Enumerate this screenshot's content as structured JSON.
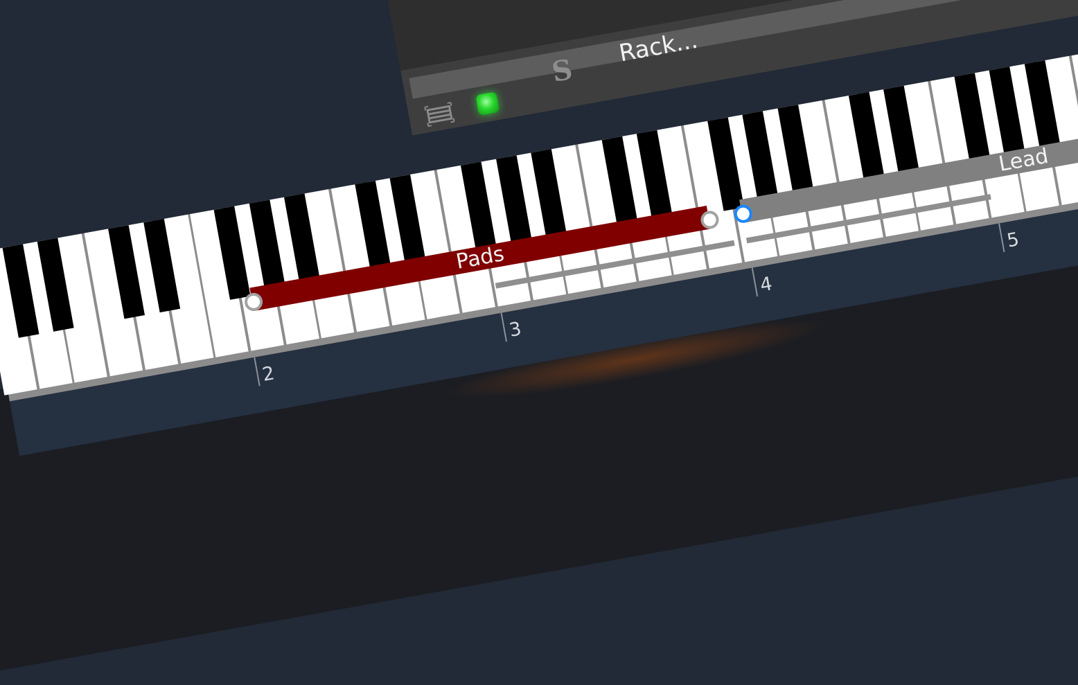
{
  "rack": {
    "name": "Rack...",
    "solo_label": "S",
    "edit_icon": "edit-frame-icon",
    "power_led_color": "#27d62b",
    "volume_slider_value": 0.75
  },
  "keyboard": {
    "white_keys_visible": 33,
    "black_key_pattern": [
      1,
      1,
      0,
      1,
      1,
      1,
      0
    ]
  },
  "zones": [
    {
      "label": "Pads",
      "color": "#800000",
      "active_handle": false
    },
    {
      "label": "Lead",
      "color": "#808080",
      "active_handle": true
    }
  ],
  "octave_labels": [
    "2",
    "3",
    "4",
    "5"
  ],
  "colors": {
    "background": "#222a37",
    "rack_panel": "#3e3e3e",
    "octave_strip": "#253041"
  }
}
